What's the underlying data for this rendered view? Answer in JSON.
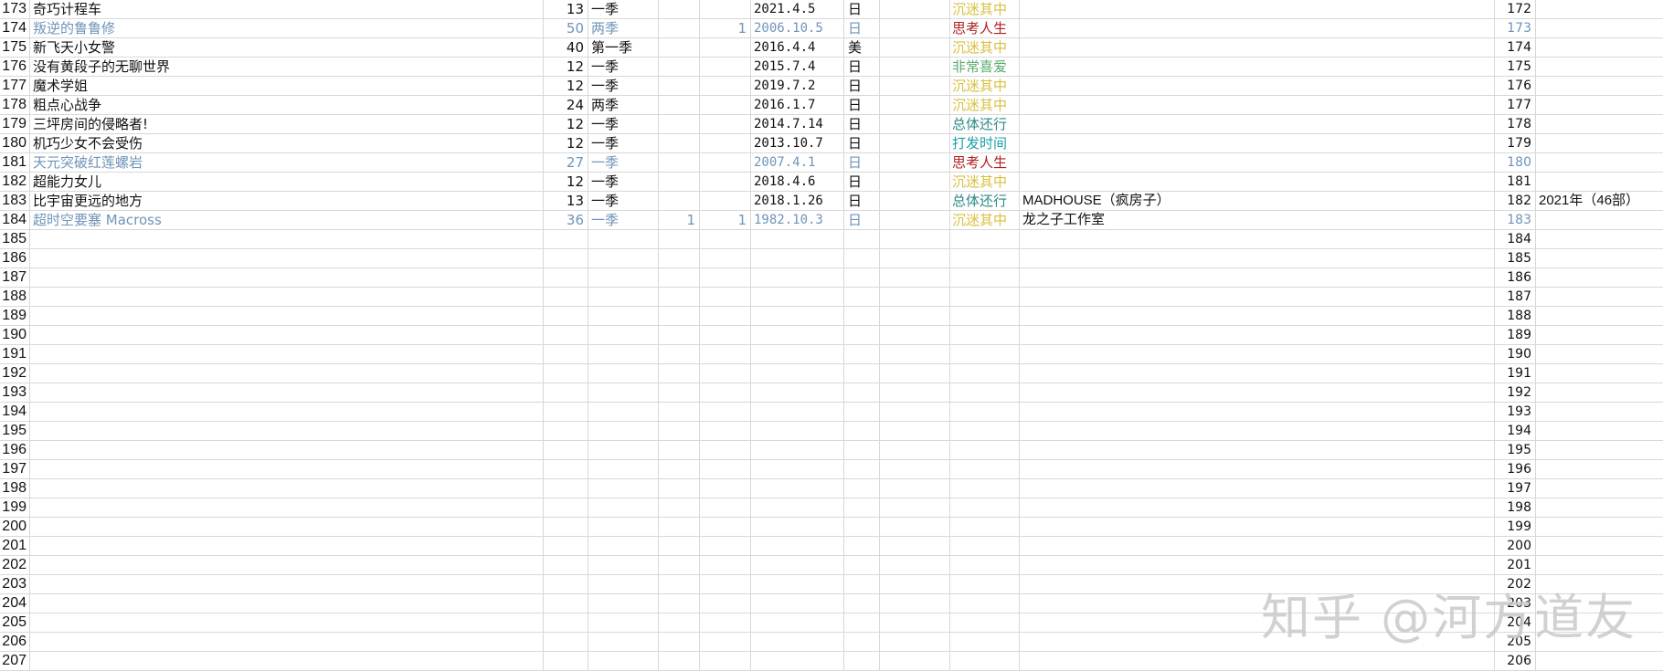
{
  "colors": {
    "grid": "#d8d8d8",
    "highlight_text": "#6f94b8",
    "status_yellow": "#d8c040",
    "status_red": "#b02020",
    "status_green": "#5aac6a",
    "status_teal": "#2a8a86",
    "status_cyan": "#1aa0a8"
  },
  "rows": [
    {
      "rn": "173",
      "name": "奇巧计程车",
      "eps": "13",
      "season": "一季",
      "e": "",
      "f": "",
      "date": "2021.4.5",
      "country": "日",
      "status": "沉迷其中",
      "status_color": "yellow",
      "studio": "",
      "idx": "172",
      "year": "",
      "highlight": false
    },
    {
      "rn": "174",
      "name": "叛逆的鲁鲁修",
      "eps": "50",
      "season": "两季",
      "e": "",
      "f": "1",
      "date": "2006.10.5",
      "country": "日",
      "status": "思考人生",
      "status_color": "red",
      "studio": "",
      "idx": "173",
      "year": "",
      "highlight": true
    },
    {
      "rn": "175",
      "name": "新飞天小女警",
      "eps": "40",
      "season": "第一季",
      "e": "",
      "f": "",
      "date": "2016.4.4",
      "country": "美",
      "status": "沉迷其中",
      "status_color": "yellow",
      "studio": "",
      "idx": "174",
      "year": "",
      "highlight": false
    },
    {
      "rn": "176",
      "name": "没有黄段子的无聊世界",
      "eps": "12",
      "season": "一季",
      "e": "",
      "f": "",
      "date": "2015.7.4",
      "country": "日",
      "status": "非常喜爱",
      "status_color": "green",
      "studio": "",
      "idx": "175",
      "year": "",
      "highlight": false
    },
    {
      "rn": "177",
      "name": "魔术学姐",
      "eps": "12",
      "season": "一季",
      "e": "",
      "f": "",
      "date": "2019.7.2",
      "country": "日",
      "status": "沉迷其中",
      "status_color": "yellow",
      "studio": "",
      "idx": "176",
      "year": "",
      "highlight": false
    },
    {
      "rn": "178",
      "name": "粗点心战争",
      "eps": "24",
      "season": "两季",
      "e": "",
      "f": "",
      "date": "2016.1.7",
      "country": "日",
      "status": "沉迷其中",
      "status_color": "yellow",
      "studio": "",
      "idx": "177",
      "year": "",
      "highlight": false
    },
    {
      "rn": "179",
      "name": "三坪房间的侵略者!",
      "eps": "12",
      "season": "一季",
      "e": "",
      "f": "",
      "date": "2014.7.14",
      "country": "日",
      "status": "总体还行",
      "status_color": "teal",
      "studio": "",
      "idx": "178",
      "year": "",
      "highlight": false
    },
    {
      "rn": "180",
      "name": "机巧少女不会受伤",
      "eps": "12",
      "season": "一季",
      "e": "",
      "f": "",
      "date": "2013.10.7",
      "country": "日",
      "status": "打发时间",
      "status_color": "cyan",
      "studio": "",
      "idx": "179",
      "year": "",
      "highlight": false
    },
    {
      "rn": "181",
      "name": "天元突破红莲螺岩",
      "eps": "27",
      "season": "一季",
      "e": "",
      "f": "",
      "date": "2007.4.1",
      "country": "日",
      "status": "思考人生",
      "status_color": "red",
      "studio": "",
      "idx": "180",
      "year": "",
      "highlight": true
    },
    {
      "rn": "182",
      "name": "超能力女儿",
      "eps": "12",
      "season": "一季",
      "e": "",
      "f": "",
      "date": "2018.4.6",
      "country": "日",
      "status": "沉迷其中",
      "status_color": "yellow",
      "studio": "",
      "idx": "181",
      "year": "",
      "highlight": false
    },
    {
      "rn": "183",
      "name": "比宇宙更远的地方",
      "eps": "13",
      "season": "一季",
      "e": "",
      "f": "",
      "date": "2018.1.26",
      "country": "日",
      "status": "总体还行",
      "status_color": "teal",
      "studio": "MADHOUSE（疯房子）",
      "idx": "182",
      "year": "2021年（46部）",
      "highlight": false
    },
    {
      "rn": "184",
      "name": "超时空要塞 Macross",
      "eps": "36",
      "season": "一季",
      "e": "1",
      "f": "1",
      "date": "1982.10.3",
      "country": "日",
      "status": "沉迷其中",
      "status_color": "yellow",
      "studio": "龙之子工作室",
      "idx": "183",
      "year": "",
      "highlight": true
    },
    {
      "rn": "185",
      "name": "",
      "eps": "",
      "season": "",
      "e": "",
      "f": "",
      "date": "",
      "country": "",
      "status": "",
      "status_color": "",
      "studio": "",
      "idx": "184",
      "year": "",
      "highlight": false
    },
    {
      "rn": "186",
      "name": "",
      "eps": "",
      "season": "",
      "e": "",
      "f": "",
      "date": "",
      "country": "",
      "status": "",
      "status_color": "",
      "studio": "",
      "idx": "185",
      "year": "",
      "highlight": false
    },
    {
      "rn": "187",
      "name": "",
      "eps": "",
      "season": "",
      "e": "",
      "f": "",
      "date": "",
      "country": "",
      "status": "",
      "status_color": "",
      "studio": "",
      "idx": "186",
      "year": "",
      "highlight": false
    },
    {
      "rn": "188",
      "name": "",
      "eps": "",
      "season": "",
      "e": "",
      "f": "",
      "date": "",
      "country": "",
      "status": "",
      "status_color": "",
      "studio": "",
      "idx": "187",
      "year": "",
      "highlight": false
    },
    {
      "rn": "189",
      "name": "",
      "eps": "",
      "season": "",
      "e": "",
      "f": "",
      "date": "",
      "country": "",
      "status": "",
      "status_color": "",
      "studio": "",
      "idx": "188",
      "year": "",
      "highlight": false
    },
    {
      "rn": "190",
      "name": "",
      "eps": "",
      "season": "",
      "e": "",
      "f": "",
      "date": "",
      "country": "",
      "status": "",
      "status_color": "",
      "studio": "",
      "idx": "189",
      "year": "",
      "highlight": false
    },
    {
      "rn": "191",
      "name": "",
      "eps": "",
      "season": "",
      "e": "",
      "f": "",
      "date": "",
      "country": "",
      "status": "",
      "status_color": "",
      "studio": "",
      "idx": "190",
      "year": "",
      "highlight": false
    },
    {
      "rn": "192",
      "name": "",
      "eps": "",
      "season": "",
      "e": "",
      "f": "",
      "date": "",
      "country": "",
      "status": "",
      "status_color": "",
      "studio": "",
      "idx": "191",
      "year": "",
      "highlight": false
    },
    {
      "rn": "193",
      "name": "",
      "eps": "",
      "season": "",
      "e": "",
      "f": "",
      "date": "",
      "country": "",
      "status": "",
      "status_color": "",
      "studio": "",
      "idx": "192",
      "year": "",
      "highlight": false
    },
    {
      "rn": "194",
      "name": "",
      "eps": "",
      "season": "",
      "e": "",
      "f": "",
      "date": "",
      "country": "",
      "status": "",
      "status_color": "",
      "studio": "",
      "idx": "193",
      "year": "",
      "highlight": false
    },
    {
      "rn": "195",
      "name": "",
      "eps": "",
      "season": "",
      "e": "",
      "f": "",
      "date": "",
      "country": "",
      "status": "",
      "status_color": "",
      "studio": "",
      "idx": "194",
      "year": "",
      "highlight": false
    },
    {
      "rn": "196",
      "name": "",
      "eps": "",
      "season": "",
      "e": "",
      "f": "",
      "date": "",
      "country": "",
      "status": "",
      "status_color": "",
      "studio": "",
      "idx": "195",
      "year": "",
      "highlight": false
    },
    {
      "rn": "197",
      "name": "",
      "eps": "",
      "season": "",
      "e": "",
      "f": "",
      "date": "",
      "country": "",
      "status": "",
      "status_color": "",
      "studio": "",
      "idx": "196",
      "year": "",
      "highlight": false
    },
    {
      "rn": "198",
      "name": "",
      "eps": "",
      "season": "",
      "e": "",
      "f": "",
      "date": "",
      "country": "",
      "status": "",
      "status_color": "",
      "studio": "",
      "idx": "197",
      "year": "",
      "highlight": false
    },
    {
      "rn": "199",
      "name": "",
      "eps": "",
      "season": "",
      "e": "",
      "f": "",
      "date": "",
      "country": "",
      "status": "",
      "status_color": "",
      "studio": "",
      "idx": "198",
      "year": "",
      "highlight": false
    },
    {
      "rn": "200",
      "name": "",
      "eps": "",
      "season": "",
      "e": "",
      "f": "",
      "date": "",
      "country": "",
      "status": "",
      "status_color": "",
      "studio": "",
      "idx": "199",
      "year": "",
      "highlight": false
    },
    {
      "rn": "201",
      "name": "",
      "eps": "",
      "season": "",
      "e": "",
      "f": "",
      "date": "",
      "country": "",
      "status": "",
      "status_color": "",
      "studio": "",
      "idx": "200",
      "year": "",
      "highlight": false
    },
    {
      "rn": "202",
      "name": "",
      "eps": "",
      "season": "",
      "e": "",
      "f": "",
      "date": "",
      "country": "",
      "status": "",
      "status_color": "",
      "studio": "",
      "idx": "201",
      "year": "",
      "highlight": false
    },
    {
      "rn": "203",
      "name": "",
      "eps": "",
      "season": "",
      "e": "",
      "f": "",
      "date": "",
      "country": "",
      "status": "",
      "status_color": "",
      "studio": "",
      "idx": "202",
      "year": "",
      "highlight": false
    },
    {
      "rn": "204",
      "name": "",
      "eps": "",
      "season": "",
      "e": "",
      "f": "",
      "date": "",
      "country": "",
      "status": "",
      "status_color": "",
      "studio": "",
      "idx": "203",
      "year": "",
      "highlight": false
    },
    {
      "rn": "205",
      "name": "",
      "eps": "",
      "season": "",
      "e": "",
      "f": "",
      "date": "",
      "country": "",
      "status": "",
      "status_color": "",
      "studio": "",
      "idx": "204",
      "year": "",
      "highlight": false
    },
    {
      "rn": "206",
      "name": "",
      "eps": "",
      "season": "",
      "e": "",
      "f": "",
      "date": "",
      "country": "",
      "status": "",
      "status_color": "",
      "studio": "",
      "idx": "205",
      "year": "",
      "highlight": false
    },
    {
      "rn": "207",
      "name": "",
      "eps": "",
      "season": "",
      "e": "",
      "f": "",
      "date": "",
      "country": "",
      "status": "",
      "status_color": "",
      "studio": "",
      "idx": "206",
      "year": "",
      "highlight": false
    }
  ],
  "watermark": "知乎 @河方道友"
}
